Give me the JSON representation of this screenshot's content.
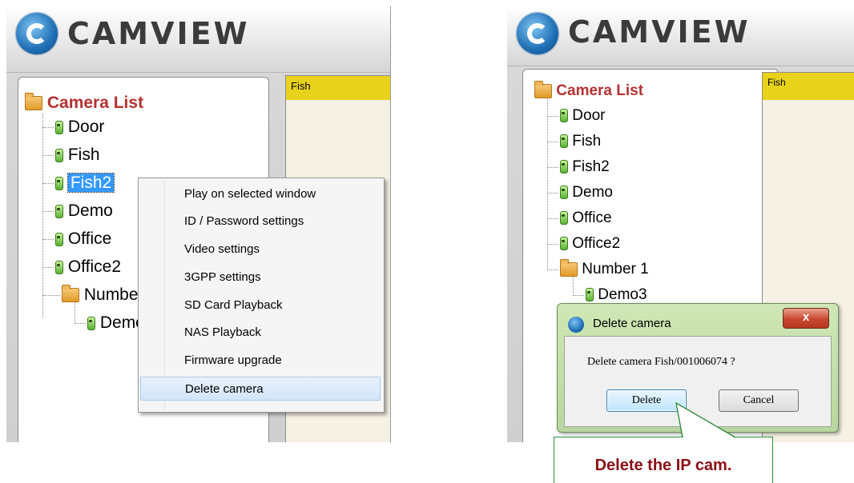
{
  "left_screen": {
    "app_title": "CAMVIEW",
    "tree": {
      "root_label": "Camera List",
      "cameras": [
        "Door",
        "Fish",
        "Fish2",
        "Demo",
        "Office",
        "Office2"
      ],
      "group_label": "Number 1",
      "group_cameras": [
        "Demo3"
      ],
      "selected": "Fish2"
    },
    "viewer_title": "Fish",
    "context_menu": {
      "items": [
        "Play on selected window",
        "ID / Password settings",
        "Video settings",
        "3GPP settings",
        "SD Card Playback",
        "NAS Playback",
        "Firmware upgrade",
        "Delete camera"
      ],
      "highlighted": "Delete camera"
    }
  },
  "right_screen": {
    "app_title": "CAMVIEW",
    "tree": {
      "root_label": "Camera List",
      "cameras": [
        "Door",
        "Fish",
        "Fish2",
        "Demo",
        "Office",
        "Office2"
      ],
      "group_label": "Number 1",
      "group_cameras": [
        "Demo3"
      ]
    },
    "viewer_title": "Fish",
    "dialog": {
      "title": "Delete camera",
      "close_label": "x",
      "message": "Delete camera Fish/001006074 ?",
      "delete_label": "Delete",
      "cancel_label": "Cancel"
    }
  },
  "callout": {
    "text": "Delete the IP cam."
  },
  "colors": {
    "accent_red": "#b33232",
    "callout_text": "#8b0f16",
    "callout_border": "#2e8b3a",
    "viewer_title_bar": "#e8d21c"
  }
}
